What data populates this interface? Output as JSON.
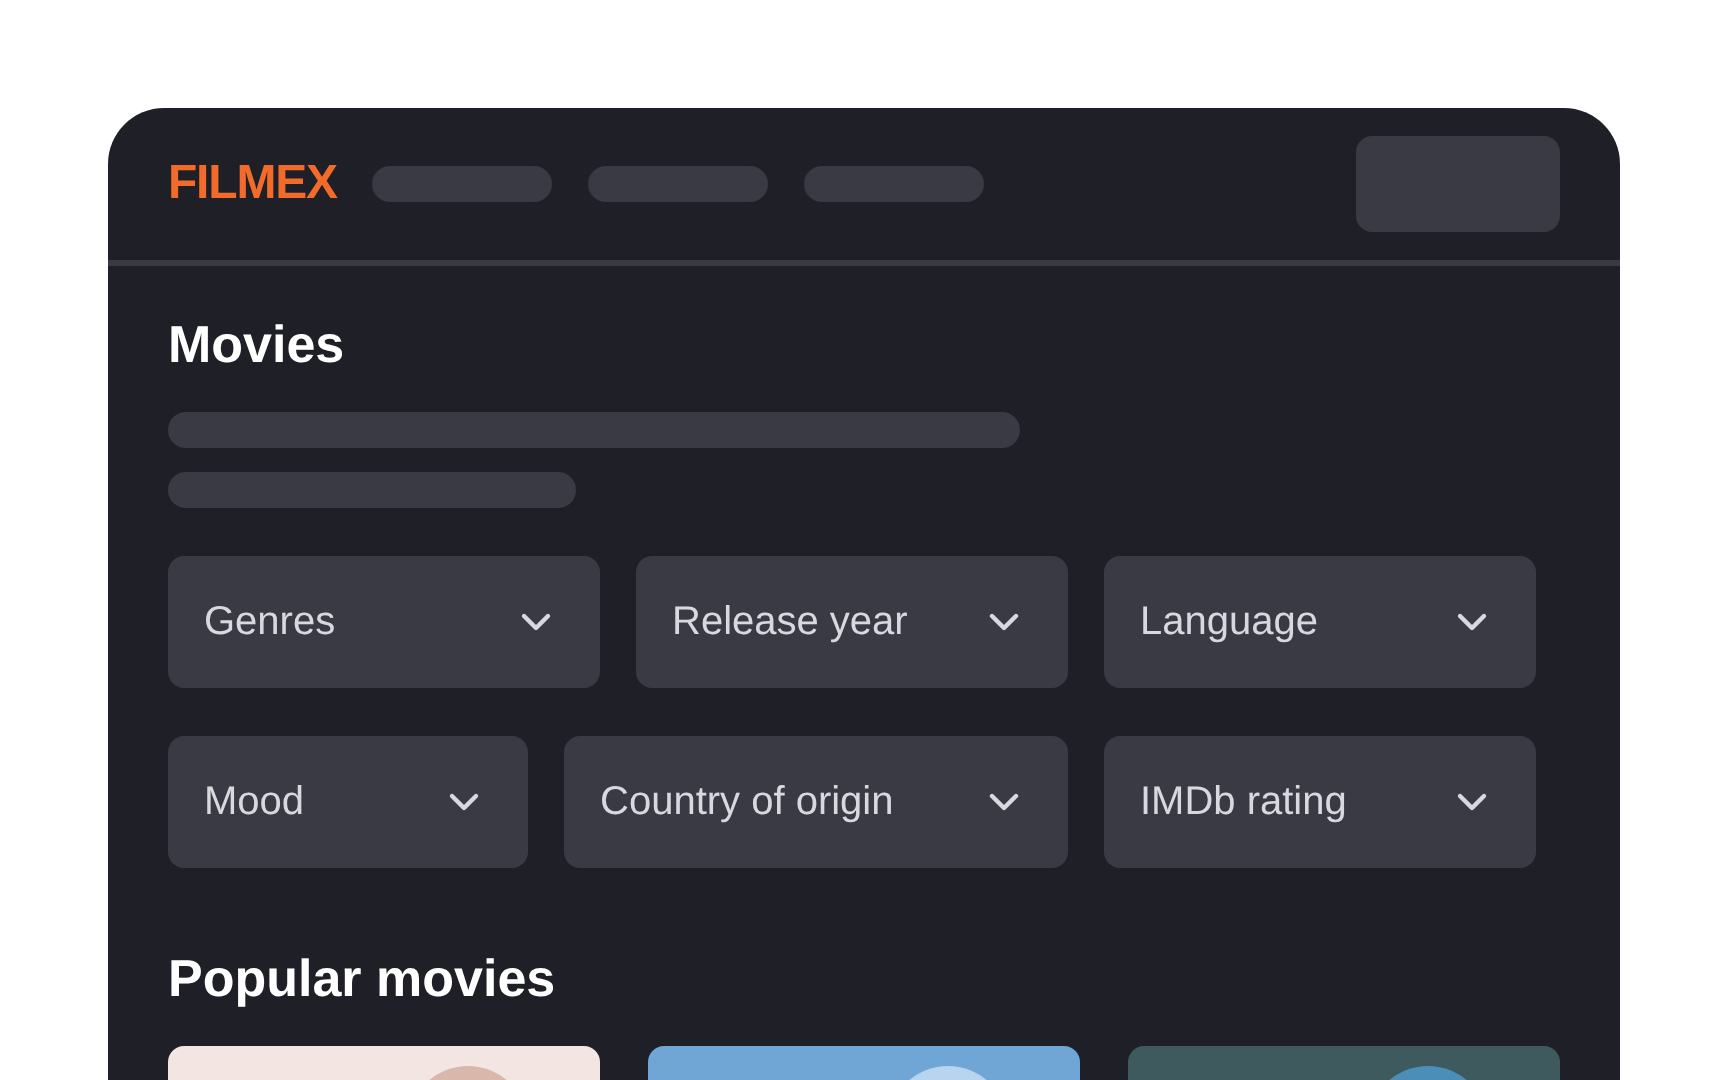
{
  "header": {
    "logo": "FILMEX"
  },
  "page_title": "Movies",
  "filters": [
    {
      "label": "Genres"
    },
    {
      "label": "Release year"
    },
    {
      "label": "Language"
    },
    {
      "label": "Mood"
    },
    {
      "label": "Country of origin"
    },
    {
      "label": "IMDb rating"
    }
  ],
  "section_title": "Popular movies"
}
